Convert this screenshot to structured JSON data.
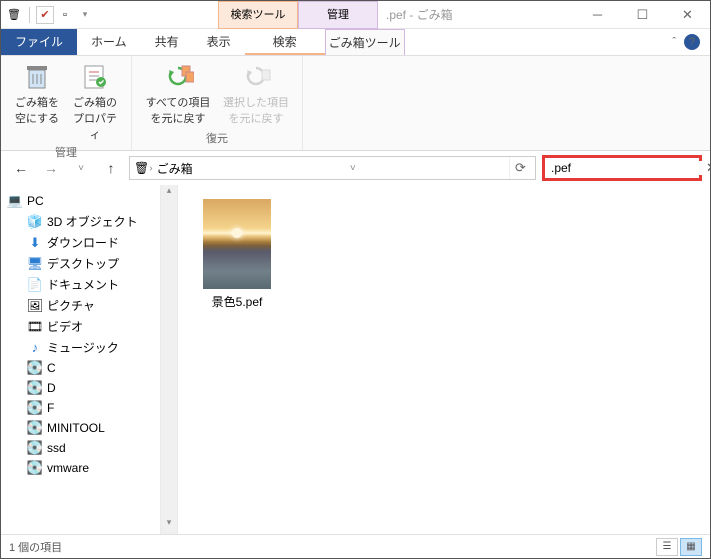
{
  "window": {
    "title": ".pef - ごみ箱"
  },
  "context_tabs": {
    "search": "検索ツール",
    "manage": "管理"
  },
  "tabs": {
    "file": "ファイル",
    "home": "ホーム",
    "share": "共有",
    "view": "表示",
    "search_sub": "検索",
    "manage_sub": "ごみ箱ツール"
  },
  "ribbon": {
    "manage": {
      "label": "管理",
      "empty": "ごみ箱を\n空にする",
      "properties": "ごみ箱の\nプロパティ"
    },
    "restore": {
      "label": "復元",
      "all": "すべての項目\nを元に戻す",
      "selected": "選択した項目\nを元に戻す"
    }
  },
  "breadcrumb": {
    "location": "ごみ箱"
  },
  "search": {
    "value": ".pef"
  },
  "tree": {
    "root": "PC",
    "items": [
      "3D オブジェクト",
      "ダウンロード",
      "デスクトップ",
      "ドキュメント",
      "ピクチャ",
      "ビデオ",
      "ミュージック",
      "C",
      "D",
      "F",
      "MINITOOL",
      "ssd",
      "vmware"
    ]
  },
  "files": [
    {
      "name": "景色5.pef"
    }
  ],
  "status": {
    "count": "1 個の項目"
  },
  "icons": {
    "3d": "🧊",
    "download": "⬇",
    "desktop": "🖥",
    "document": "📄",
    "picture": "🖼",
    "video": "🎞",
    "music": "♪",
    "drive": "💽"
  }
}
